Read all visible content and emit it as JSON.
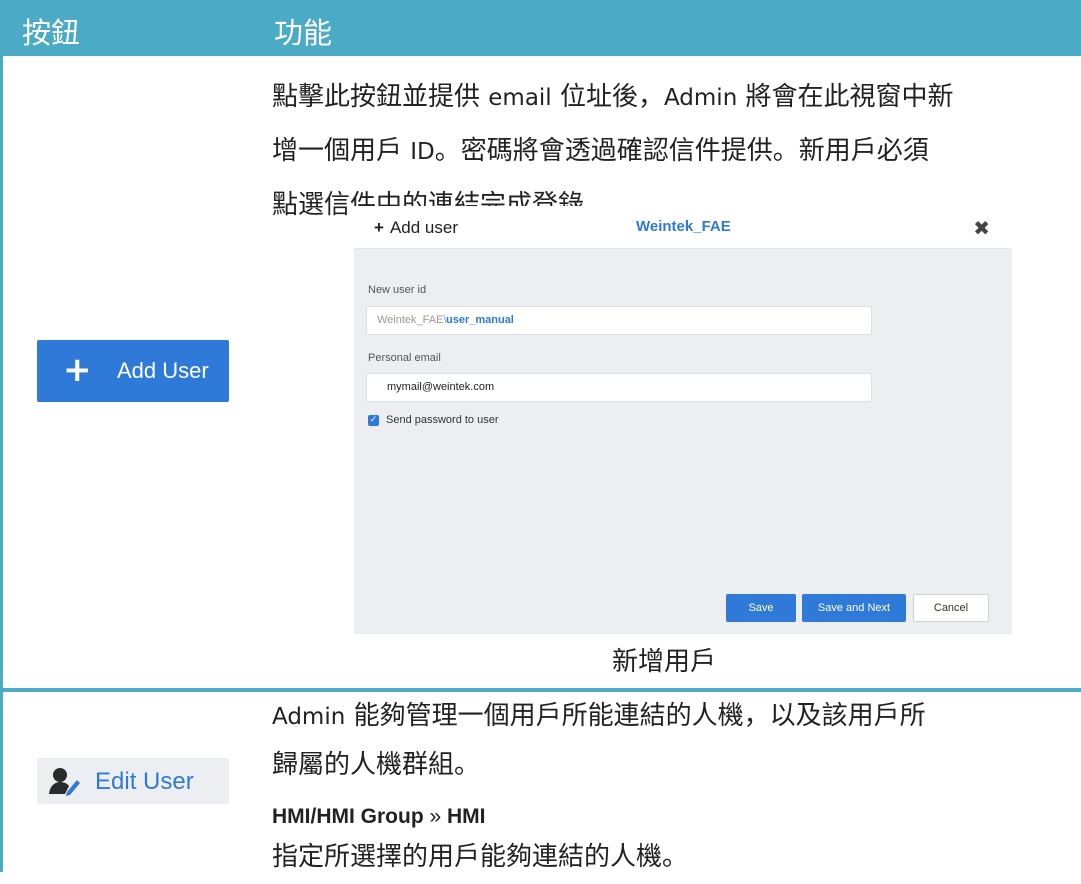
{
  "header": {
    "col_button": "按鈕",
    "col_function": "功能"
  },
  "rows": [
    {
      "button_label": "Add User",
      "desc_line1_a": "點擊此按鈕並提供 ",
      "desc_line1_b": "email",
      "desc_line1_c": " 位址後，",
      "desc_line1_d": "Admin",
      "desc_line1_e": " 將會在此視窗中新",
      "desc_line2_a": "增一個用戶 ",
      "desc_line2_b": "ID",
      "desc_line2_c": "。密碼將會透過確認信件提供。新用戶必須",
      "desc_line3": "點選信件中的連結完成登錄。",
      "dialog": {
        "title": "Add user",
        "domain": "Weintek_FAE",
        "new_user_id_label": "New user id",
        "user_prefix": "Weintek_FAE\\",
        "user_name": "user_manual",
        "personal_email_label": "Personal email",
        "email_value": "mymail@weintek.com",
        "send_password_label": "Send password to user",
        "save_label": "Save",
        "save_next_label": "Save and Next",
        "cancel_label": "Cancel"
      },
      "caption": "新增用戶"
    },
    {
      "button_label": "Edit User",
      "desc_line1_a": "Admin",
      "desc_line1_b": " 能夠管理一個用戶所能連結的人機，以及該用戶所",
      "desc_line2": "歸屬的人機群組。",
      "sub_heading_a": "HMI/HMI Group",
      "sub_heading_sep": " » ",
      "sub_heading_b": "HMI",
      "desc_line3": "指定所選擇的用戶能夠連結的人機。"
    }
  ],
  "colors": {
    "header_bg": "#4babc6",
    "accent_blue": "#2f7ad8"
  }
}
